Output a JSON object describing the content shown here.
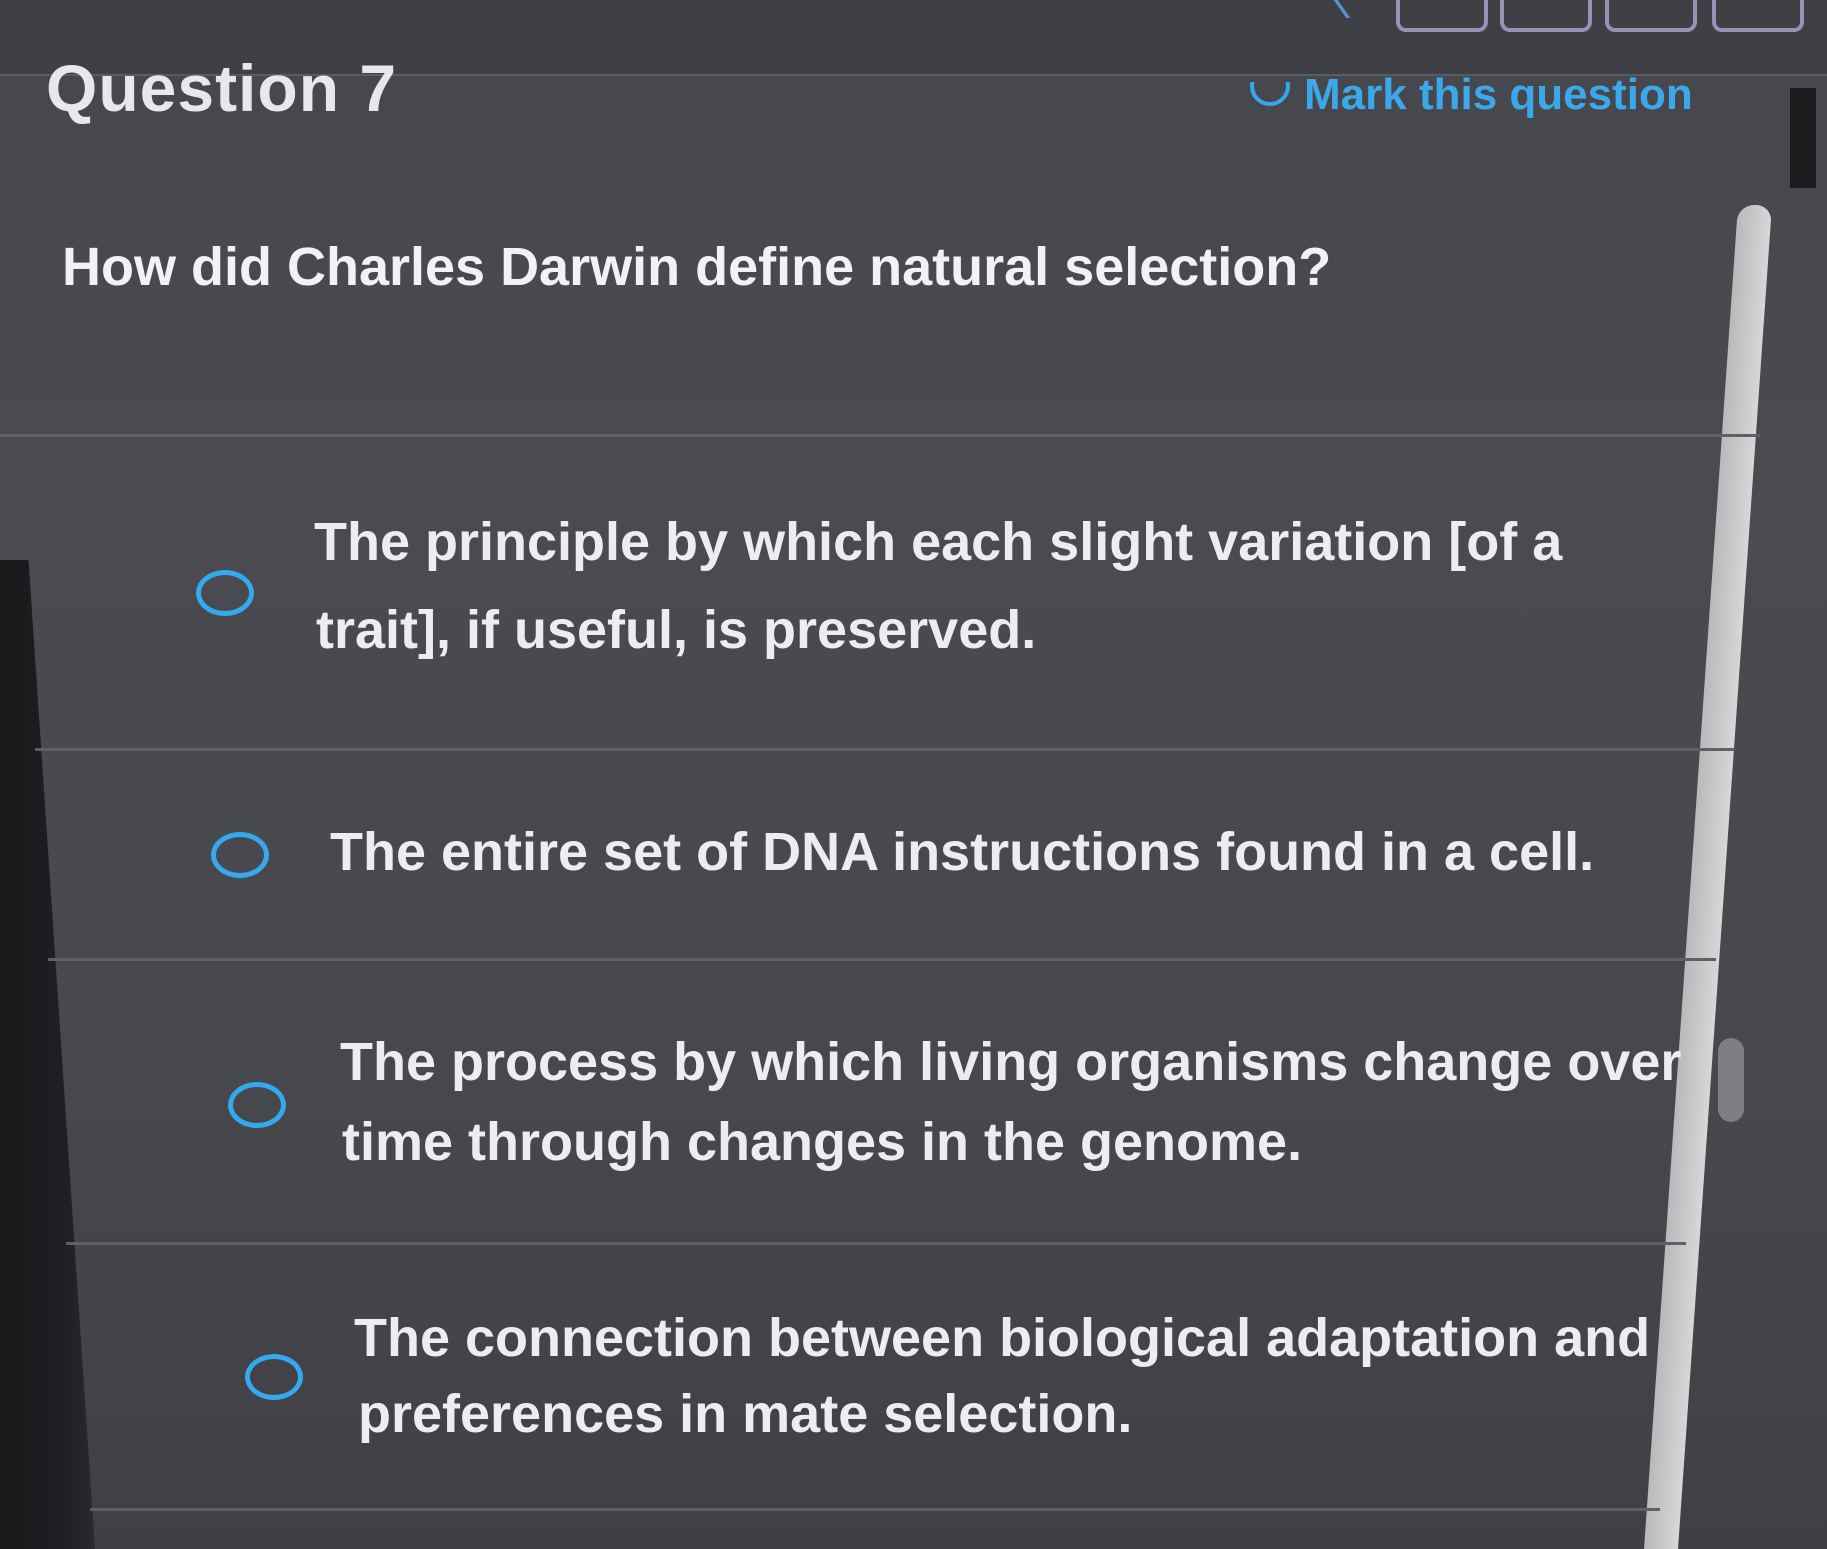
{
  "header": {
    "question_label": "Question 7",
    "mark_label": "Mark this question"
  },
  "question": {
    "text": "How did Charles Darwin define natural selection?"
  },
  "options": [
    {
      "line1": "The principle by which each slight variation [of a",
      "line2": "trait], if useful, is preserved.",
      "selected": false
    },
    {
      "line1": "The entire set of DNA instructions found in a cell.",
      "line2": "",
      "selected": false
    },
    {
      "line1": "The process by which living organisms change over",
      "line2": "time through changes in the genome.",
      "selected": false
    },
    {
      "line1": "The connection between biological adaptation and",
      "line2": "preferences in mate selection.",
      "selected": false
    }
  ],
  "colors": {
    "accent": "#33a9ee",
    "background": "#47484d",
    "text": "#ededef"
  }
}
